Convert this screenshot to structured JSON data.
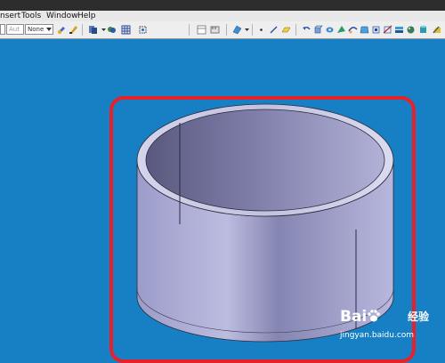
{
  "menu": {
    "items": [
      "nsert",
      "Tools",
      "Window",
      "Help"
    ]
  },
  "toolbar": {
    "combo1": "Aut",
    "combo2": "None"
  },
  "watermark": {
    "brand": "Bai",
    "brand_suffix": "经验",
    "url": "jingyan.baidu.com"
  },
  "colors": {
    "viewport_bg": "#1780c4",
    "highlight": "#e8202a",
    "part_surface": "#a9a9d0"
  }
}
